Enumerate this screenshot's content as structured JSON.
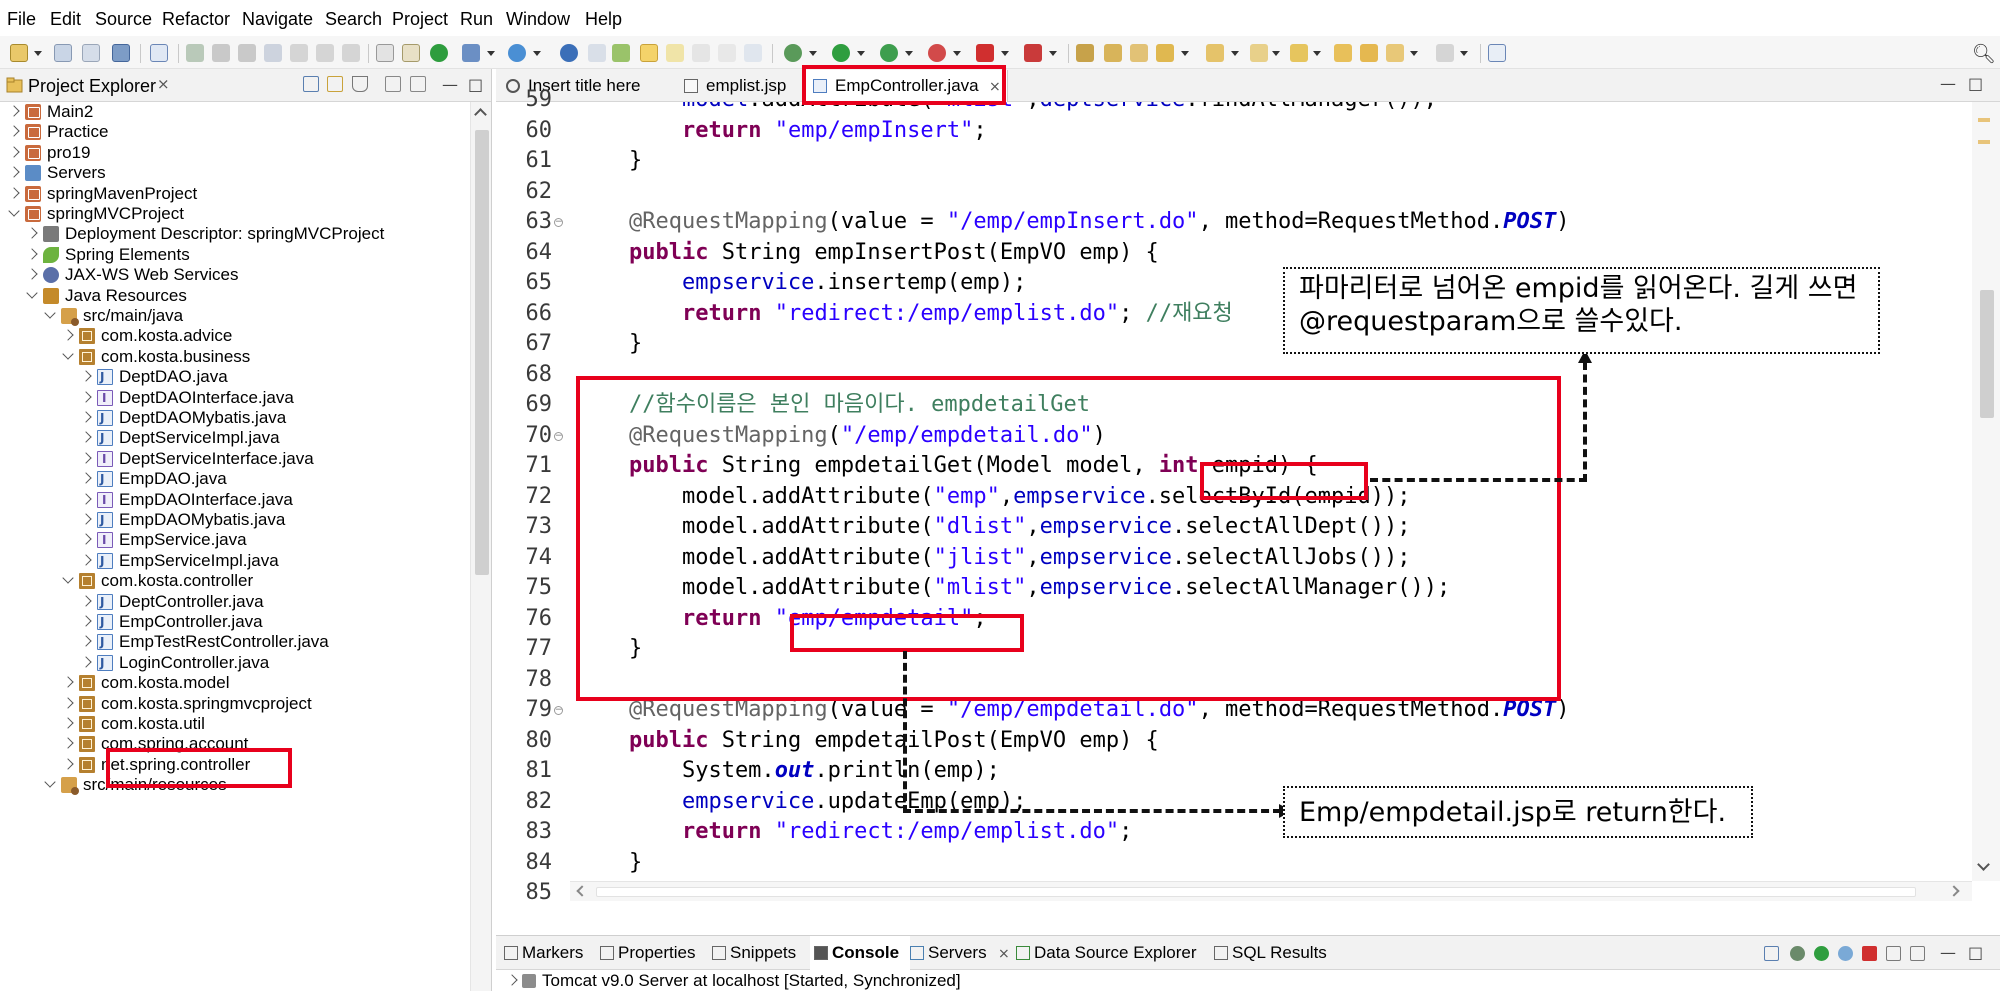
{
  "menu": [
    "File",
    "Edit",
    "Source",
    "Refactor",
    "Navigate",
    "Search",
    "Project",
    "Run",
    "Window",
    "Help"
  ],
  "explorer": {
    "title": "Project Explorer",
    "items": [
      {
        "label": "Main2",
        "depth": 0,
        "open": false,
        "icon": "project-icon"
      },
      {
        "label": "Practice",
        "depth": 0,
        "open": false,
        "icon": "project-icon"
      },
      {
        "label": "pro19",
        "depth": 0,
        "open": false,
        "icon": "project-icon"
      },
      {
        "label": "Servers",
        "depth": 0,
        "open": false,
        "icon": "servers-folder-icon"
      },
      {
        "label": "springMavenProject",
        "depth": 0,
        "open": false,
        "icon": "project-icon"
      },
      {
        "label": "springMVCProject",
        "depth": 0,
        "open": true,
        "icon": "project-icon"
      },
      {
        "label": "Deployment Descriptor: springMVCProject",
        "depth": 1,
        "open": false,
        "icon": "deployment-descriptor-icon"
      },
      {
        "label": "Spring Elements",
        "depth": 1,
        "open": false,
        "icon": "spring-leaf-icon"
      },
      {
        "label": "JAX-WS Web Services",
        "depth": 1,
        "open": false,
        "icon": "web-services-icon"
      },
      {
        "label": "Java Resources",
        "depth": 1,
        "open": true,
        "icon": "java-resources-icon"
      },
      {
        "label": "src/main/java",
        "depth": 2,
        "open": true,
        "icon": "source-folder-icon"
      },
      {
        "label": "com.kosta.advice",
        "depth": 3,
        "open": false,
        "icon": "package-icon"
      },
      {
        "label": "com.kosta.business",
        "depth": 3,
        "open": true,
        "icon": "package-icon"
      },
      {
        "label": "DeptDAO.java",
        "depth": 4,
        "open": false,
        "icon": "java-class-icon"
      },
      {
        "label": "DeptDAOInterface.java",
        "depth": 4,
        "open": false,
        "icon": "java-interface-icon"
      },
      {
        "label": "DeptDAOMybatis.java",
        "depth": 4,
        "open": false,
        "icon": "java-class-icon"
      },
      {
        "label": "DeptServiceImpl.java",
        "depth": 4,
        "open": false,
        "icon": "java-class-icon"
      },
      {
        "label": "DeptServiceInterface.java",
        "depth": 4,
        "open": false,
        "icon": "java-interface-icon"
      },
      {
        "label": "EmpDAO.java",
        "depth": 4,
        "open": false,
        "icon": "java-class-icon"
      },
      {
        "label": "EmpDAOInterface.java",
        "depth": 4,
        "open": false,
        "icon": "java-interface-icon"
      },
      {
        "label": "EmpDAOMybatis.java",
        "depth": 4,
        "open": false,
        "icon": "java-class-icon"
      },
      {
        "label": "EmpService.java",
        "depth": 4,
        "open": false,
        "icon": "java-interface-icon"
      },
      {
        "label": "EmpServiceImpl.java",
        "depth": 4,
        "open": false,
        "icon": "java-class-icon"
      },
      {
        "label": "com.kosta.controller",
        "depth": 3,
        "open": true,
        "icon": "package-icon"
      },
      {
        "label": "DeptController.java",
        "depth": 4,
        "open": false,
        "icon": "java-class-icon"
      },
      {
        "label": "EmpController.java",
        "depth": 4,
        "open": false,
        "icon": "java-class-icon",
        "highlight": true
      },
      {
        "label": "EmpTestRestController.java",
        "depth": 4,
        "open": false,
        "icon": "java-class-icon"
      },
      {
        "label": "LoginController.java",
        "depth": 4,
        "open": false,
        "icon": "java-class-icon"
      },
      {
        "label": "com.kosta.model",
        "depth": 3,
        "open": false,
        "icon": "package-icon"
      },
      {
        "label": "com.kosta.springmvcproject",
        "depth": 3,
        "open": false,
        "icon": "package-icon"
      },
      {
        "label": "com.kosta.util",
        "depth": 3,
        "open": false,
        "icon": "package-icon"
      },
      {
        "label": "com.spring.account",
        "depth": 3,
        "open": false,
        "icon": "package-icon"
      },
      {
        "label": "net.spring.controller",
        "depth": 3,
        "open": false,
        "icon": "package-icon"
      },
      {
        "label": "src/main/resources",
        "depth": 2,
        "open": true,
        "icon": "source-folder-icon"
      }
    ]
  },
  "editor": {
    "tabs": [
      {
        "label": "Insert title here",
        "icon": "globe-icon",
        "active": false
      },
      {
        "label": "emplist.jsp",
        "icon": "jsp-file-icon",
        "active": false
      },
      {
        "label": "EmpController.java",
        "icon": "java-file-icon",
        "active": true
      }
    ],
    "lines": [
      {
        "num": "59",
        "fold": false,
        "segs": [
          [
            "",
            "        "
          ],
          [
            "fld",
            "model"
          ],
          [
            "",
            ".addAttribute("
          ],
          [
            "str",
            "\"mlist\""
          ],
          [
            "",
            ","
          ],
          [
            "fld",
            "deptservice"
          ],
          [
            "",
            ".findAllManager());"
          ]
        ]
      },
      {
        "num": "60",
        "fold": false,
        "segs": [
          [
            "",
            "        "
          ],
          [
            "kw",
            "return"
          ],
          [
            "",
            " "
          ],
          [
            "str",
            "\"emp/empInsert\""
          ],
          [
            "",
            ";"
          ]
        ]
      },
      {
        "num": "61",
        "fold": false,
        "segs": [
          [
            "",
            "    }"
          ]
        ]
      },
      {
        "num": "62",
        "fold": false,
        "segs": [
          [
            "",
            ""
          ]
        ]
      },
      {
        "num": "63",
        "fold": true,
        "segs": [
          [
            "",
            "    "
          ],
          [
            "ann",
            "@RequestMapping"
          ],
          [
            "",
            "(value = "
          ],
          [
            "str",
            "\"/emp/empInsert.do\""
          ],
          [
            "",
            ", method=RequestMethod."
          ],
          [
            "sfld",
            "POST"
          ],
          [
            "",
            ")"
          ]
        ]
      },
      {
        "num": "64",
        "fold": false,
        "segs": [
          [
            "",
            "    "
          ],
          [
            "kw",
            "public"
          ],
          [
            "",
            " String empInsertPost(EmpVO emp) {"
          ]
        ]
      },
      {
        "num": "65",
        "fold": false,
        "segs": [
          [
            "",
            "        "
          ],
          [
            "fld",
            "empservice"
          ],
          [
            "",
            ".insertemp(emp);"
          ]
        ]
      },
      {
        "num": "66",
        "fold": false,
        "segs": [
          [
            "",
            "        "
          ],
          [
            "kw",
            "return"
          ],
          [
            "",
            " "
          ],
          [
            "str",
            "\"redirect:/emp/emplist.do\""
          ],
          [
            "",
            "; "
          ],
          [
            "cm",
            "//재요청"
          ]
        ]
      },
      {
        "num": "67",
        "fold": false,
        "segs": [
          [
            "",
            "    }"
          ]
        ]
      },
      {
        "num": "68",
        "fold": false,
        "segs": [
          [
            "",
            ""
          ]
        ]
      },
      {
        "num": "69",
        "fold": false,
        "segs": [
          [
            "",
            "    "
          ],
          [
            "cm",
            "//함수이름은 본인 마음이다. empdetailGet"
          ]
        ]
      },
      {
        "num": "70",
        "fold": true,
        "segs": [
          [
            "",
            "    "
          ],
          [
            "ann",
            "@RequestMapping"
          ],
          [
            "",
            "("
          ],
          [
            "str",
            "\"/emp/empdetail.do\""
          ],
          [
            "",
            ")"
          ]
        ]
      },
      {
        "num": "71",
        "fold": false,
        "segs": [
          [
            "",
            "    "
          ],
          [
            "kw",
            "public"
          ],
          [
            "",
            " String empdetailGet(Model model, "
          ],
          [
            "kw",
            "int"
          ],
          [
            "",
            " empid) {"
          ]
        ]
      },
      {
        "num": "72",
        "fold": false,
        "segs": [
          [
            "",
            "        model.addAttribute("
          ],
          [
            "str",
            "\"emp\""
          ],
          [
            "",
            ","
          ],
          [
            "fld",
            "empservice"
          ],
          [
            "",
            ".selectById(empid));"
          ]
        ]
      },
      {
        "num": "73",
        "fold": false,
        "segs": [
          [
            "",
            "        model.addAttribute("
          ],
          [
            "str",
            "\"dlist\""
          ],
          [
            "",
            ","
          ],
          [
            "fld",
            "empservice"
          ],
          [
            "",
            ".selectAllDept());"
          ]
        ]
      },
      {
        "num": "74",
        "fold": false,
        "segs": [
          [
            "",
            "        model.addAttribute("
          ],
          [
            "str",
            "\"jlist\""
          ],
          [
            "",
            ","
          ],
          [
            "fld",
            "empservice"
          ],
          [
            "",
            ".selectAllJobs());"
          ]
        ]
      },
      {
        "num": "75",
        "fold": false,
        "segs": [
          [
            "",
            "        model.addAttribute("
          ],
          [
            "str",
            "\"mlist\""
          ],
          [
            "",
            ","
          ],
          [
            "fld",
            "empservice"
          ],
          [
            "",
            ".selectAllManager());"
          ]
        ]
      },
      {
        "num": "76",
        "fold": false,
        "segs": [
          [
            "",
            "        "
          ],
          [
            "kw",
            "return"
          ],
          [
            "",
            " "
          ],
          [
            "str",
            "\"emp/empdetail\""
          ],
          [
            "",
            ";"
          ]
        ]
      },
      {
        "num": "77",
        "fold": false,
        "segs": [
          [
            "",
            "    }"
          ]
        ]
      },
      {
        "num": "78",
        "fold": false,
        "segs": [
          [
            "",
            ""
          ]
        ]
      },
      {
        "num": "79",
        "fold": true,
        "segs": [
          [
            "",
            "    "
          ],
          [
            "ann",
            "@RequestMapping"
          ],
          [
            "",
            "(value = "
          ],
          [
            "str",
            "\"/emp/empdetail.do\""
          ],
          [
            "",
            ", method=RequestMethod."
          ],
          [
            "sfld",
            "POST"
          ],
          [
            "",
            ")"
          ]
        ]
      },
      {
        "num": "80",
        "fold": false,
        "segs": [
          [
            "",
            "    "
          ],
          [
            "kw",
            "public"
          ],
          [
            "",
            " String empdetailPost(EmpVO emp) {"
          ]
        ]
      },
      {
        "num": "81",
        "fold": false,
        "segs": [
          [
            "",
            "        System."
          ],
          [
            "sfld",
            "out"
          ],
          [
            "",
            ".println(emp);"
          ]
        ]
      },
      {
        "num": "82",
        "fold": false,
        "segs": [
          [
            "",
            "        "
          ],
          [
            "fld",
            "empservice"
          ],
          [
            "",
            ".updateEmp(emp);"
          ]
        ]
      },
      {
        "num": "83",
        "fold": false,
        "segs": [
          [
            "",
            "        "
          ],
          [
            "kw",
            "return"
          ],
          [
            "",
            " "
          ],
          [
            "str",
            "\"redirect:/emp/emplist.do\""
          ],
          [
            "",
            ";"
          ]
        ]
      },
      {
        "num": "84",
        "fold": false,
        "segs": [
          [
            "",
            "    }"
          ]
        ]
      },
      {
        "num": "85",
        "fold": false,
        "segs": [
          [
            "",
            ""
          ]
        ]
      }
    ]
  },
  "bottom": {
    "tabs": [
      "Markers",
      "Properties",
      "Snippets",
      "Console",
      "Servers",
      "Data Source Explorer",
      "SQL Results"
    ],
    "server_line": "Tomcat v9.0 Server at localhost  [Started, Synchronized]"
  },
  "annotations": {
    "note_param": "파마리터로 넘어온 empid를 읽어온다. 길게 쓰면 @requestparam으로 쓸수있다.",
    "note_return": "Emp/empdetail.jsp로 return한다."
  },
  "colors": {
    "keyword": "#7f0055",
    "string": "#2a00ff",
    "comment": "#3f7f5f",
    "annotation_highlight": "#e8001c"
  }
}
